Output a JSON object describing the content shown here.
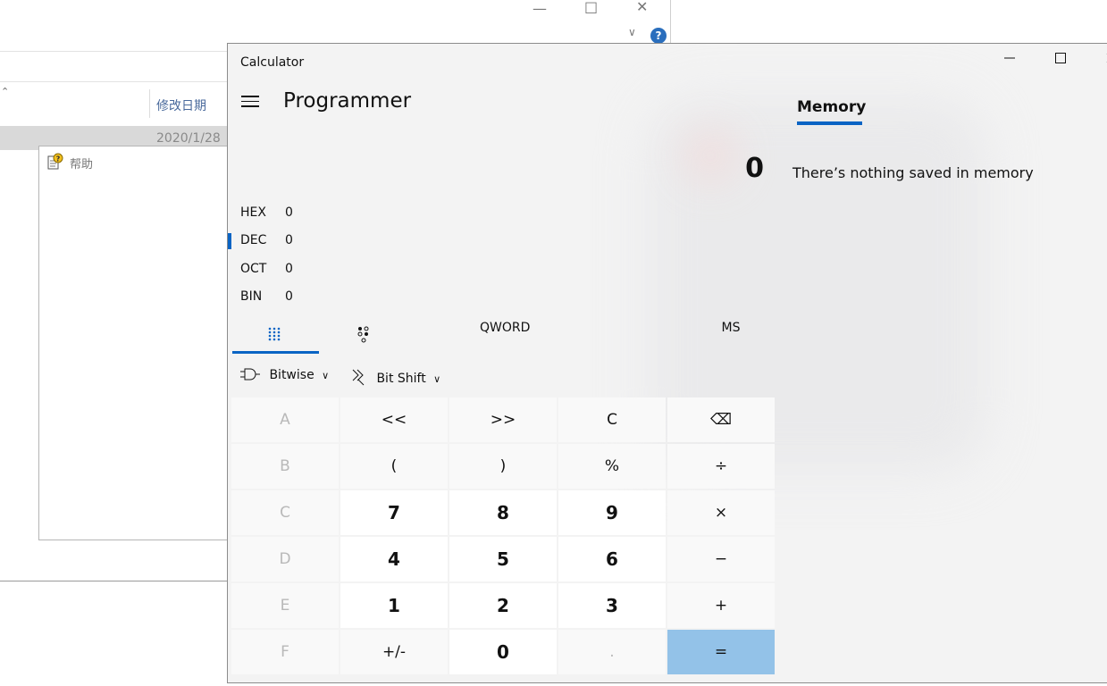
{
  "explorer": {
    "column_header": "修改日期",
    "row_date": "2020/1/28",
    "help_badge": "?"
  },
  "help_dialog": {
    "label": "帮助"
  },
  "calculator": {
    "title": "Calculator",
    "mode": "Programmer",
    "display": "0",
    "memory": {
      "tab_label": "Memory",
      "empty_message": "There’s nothing saved in memory"
    },
    "radix": [
      {
        "name": "HEX",
        "value": "0"
      },
      {
        "name": "DEC",
        "value": "0",
        "selected": true
      },
      {
        "name": "OCT",
        "value": "0"
      },
      {
        "name": "BIN",
        "value": "0"
      }
    ],
    "tabs": {
      "word_size": "QWORD",
      "ms": "MS",
      "active": "full-keypad"
    },
    "bitwise": {
      "bitwise_label": "Bitwise",
      "bitshift_label": "Bit Shift"
    },
    "keys": [
      [
        "A",
        "<<",
        ">>",
        "C",
        "⌫"
      ],
      [
        "B",
        "(",
        ")",
        "%",
        "÷"
      ],
      [
        "C",
        "7",
        "8",
        "9",
        "×"
      ],
      [
        "D",
        "4",
        "5",
        "6",
        "−"
      ],
      [
        "E",
        "1",
        "2",
        "3",
        "+"
      ],
      [
        "F",
        "+/-",
        "0",
        ".",
        "="
      ]
    ],
    "accent_color": "#0a64c4",
    "equals_color": "#93c2e8"
  }
}
